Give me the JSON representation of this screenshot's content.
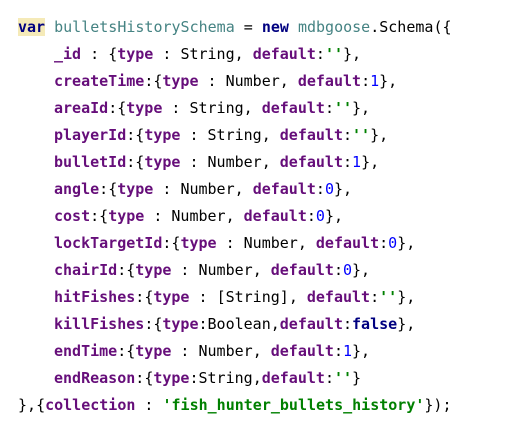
{
  "code": {
    "declaration": {
      "keyword_var": "var",
      "variable_name": "bulletsHistorySchema",
      "assign": " = ",
      "keyword_new": "new",
      "module": "mdbgoose",
      "dot": ".",
      "constructor": "Schema",
      "open": "({"
    },
    "fields": [
      {
        "name": "_id",
        "sep": " : ",
        "open": "{",
        "type_kw": "type",
        "colon": " : ",
        "type_name": "String",
        "comma": ", ",
        "default_kw": "default",
        "dcolon": ":",
        "default_value": "''",
        "default_kind": "str",
        "close": "},"
      },
      {
        "name": "createTime",
        "sep": ":",
        "open": "{",
        "type_kw": "type",
        "colon": " : ",
        "type_name": "Number",
        "comma": ", ",
        "default_kw": "default",
        "dcolon": ":",
        "default_value": "1",
        "default_kind": "num",
        "close": "},"
      },
      {
        "name": "areaId",
        "sep": ":",
        "open": "{",
        "type_kw": "type",
        "colon": " : ",
        "type_name": "String",
        "comma": ", ",
        "default_kw": "default",
        "dcolon": ":",
        "default_value": "''",
        "default_kind": "str",
        "close": "},"
      },
      {
        "name": "playerId",
        "sep": ":",
        "open": "{",
        "type_kw": "type",
        "colon": " : ",
        "type_name": "String",
        "comma": ", ",
        "default_kw": "default",
        "dcolon": ":",
        "default_value": "''",
        "default_kind": "str",
        "close": "},"
      },
      {
        "name": "bulletId",
        "sep": ":",
        "open": "{",
        "type_kw": "type",
        "colon": " : ",
        "type_name": "Number",
        "comma": ", ",
        "default_kw": "default",
        "dcolon": ":",
        "default_value": "1",
        "default_kind": "num",
        "close": "},"
      },
      {
        "name": "angle",
        "sep": ":",
        "open": "{",
        "type_kw": "type",
        "colon": " : ",
        "type_name": "Number",
        "comma": ", ",
        "default_kw": "default",
        "dcolon": ":",
        "default_value": "0",
        "default_kind": "num",
        "close": "},"
      },
      {
        "name": "cost",
        "sep": ":",
        "open": "{",
        "type_kw": "type",
        "colon": " : ",
        "type_name": "Number",
        "comma": ", ",
        "default_kw": "default",
        "dcolon": ":",
        "default_value": "0",
        "default_kind": "num",
        "close": "},"
      },
      {
        "name": "lockTargetId",
        "sep": ":",
        "open": "{",
        "type_kw": "type",
        "colon": " : ",
        "type_name": "Number",
        "comma": ", ",
        "default_kw": "default",
        "dcolon": ":",
        "default_value": "0",
        "default_kind": "num",
        "close": "},"
      },
      {
        "name": "chairId",
        "sep": ":",
        "open": "{",
        "type_kw": "type",
        "colon": " : ",
        "type_name": "Number",
        "comma": ", ",
        "default_kw": "default",
        "dcolon": ":",
        "default_value": "0",
        "default_kind": "num",
        "close": "},"
      },
      {
        "name": "hitFishes",
        "sep": ":",
        "open": "{",
        "type_kw": "type",
        "colon": " : ",
        "type_name": "[String]",
        "comma": ", ",
        "default_kw": "default",
        "dcolon": ":",
        "default_value": "''",
        "default_kind": "str",
        "close": "},"
      },
      {
        "name": "killFishes",
        "sep": ":",
        "open": "{",
        "type_kw": "type",
        "colon": ":",
        "type_name": "Boolean",
        "comma": ",",
        "default_kw": "default",
        "dcolon": ":",
        "default_value": "false",
        "default_kind": "kw",
        "close": "},"
      },
      {
        "name": "endTime",
        "sep": ":",
        "open": "{",
        "type_kw": "type",
        "colon": " : ",
        "type_name": "Number",
        "comma": ", ",
        "default_kw": "default",
        "dcolon": ":",
        "default_value": "1",
        "default_kind": "num",
        "close": "},"
      },
      {
        "name": "endReason",
        "sep": ":",
        "open": "{",
        "type_kw": "type",
        "colon": ":",
        "type_name": "String",
        "comma": ",",
        "default_kw": "default",
        "dcolon": ":",
        "default_value": "''",
        "default_kind": "str",
        "close": "}"
      }
    ],
    "closing": {
      "brace": "},",
      "open": "{",
      "collection_kw": "collection",
      "colon": " : ",
      "collection_value": "'fish_hunter_bullets_history'",
      "end": "});"
    }
  },
  "colors": {
    "keyword": "#000080",
    "identifier": "#458383",
    "field": "#660e7a",
    "string": "#008000",
    "number": "#0000ff",
    "var_highlight": "#f5eab8"
  }
}
